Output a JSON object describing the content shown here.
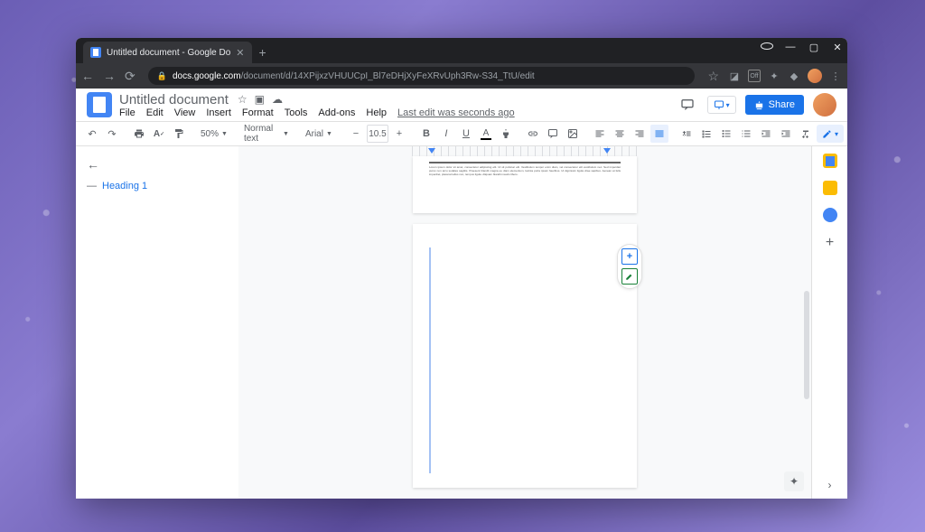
{
  "browser": {
    "tab_title": "Untitled document - Google Do",
    "url_domain": "docs.google.com",
    "url_path": "/document/d/14XPijxzVHUUCpI_Bl7eDHjXyFeXRvUph3Rw-S34_TtU/edit"
  },
  "docs": {
    "title": "Untitled document",
    "menus": {
      "file": "File",
      "edit": "Edit",
      "view": "View",
      "insert": "Insert",
      "format": "Format",
      "tools": "Tools",
      "addons": "Add-ons",
      "help": "Help"
    },
    "last_edit": "Last edit was seconds ago",
    "share_label": "Share"
  },
  "toolbar": {
    "zoom": "50%",
    "style": "Normal text",
    "font": "Arial",
    "size": "10.5"
  },
  "outline": {
    "heading1": "Heading 1"
  },
  "page1_text": "Lorem ipsum dolor sit amet, consectetur adipiscing elit. Ut sit pulvinar elit. Vestibulum tempor enim diam, vel consectetur elit vestibulum nec. Sed imperdiet purus non arcu sodales sagittis. Praesent blandit magna eu diam elementum, lacinia porta ipsum faucibus. Ut dignissim ligula vitae sapibus. Aenean at felis imperdiet, placerat tellus non, tempus ligula. Aliquam blandit mauris libero."
}
